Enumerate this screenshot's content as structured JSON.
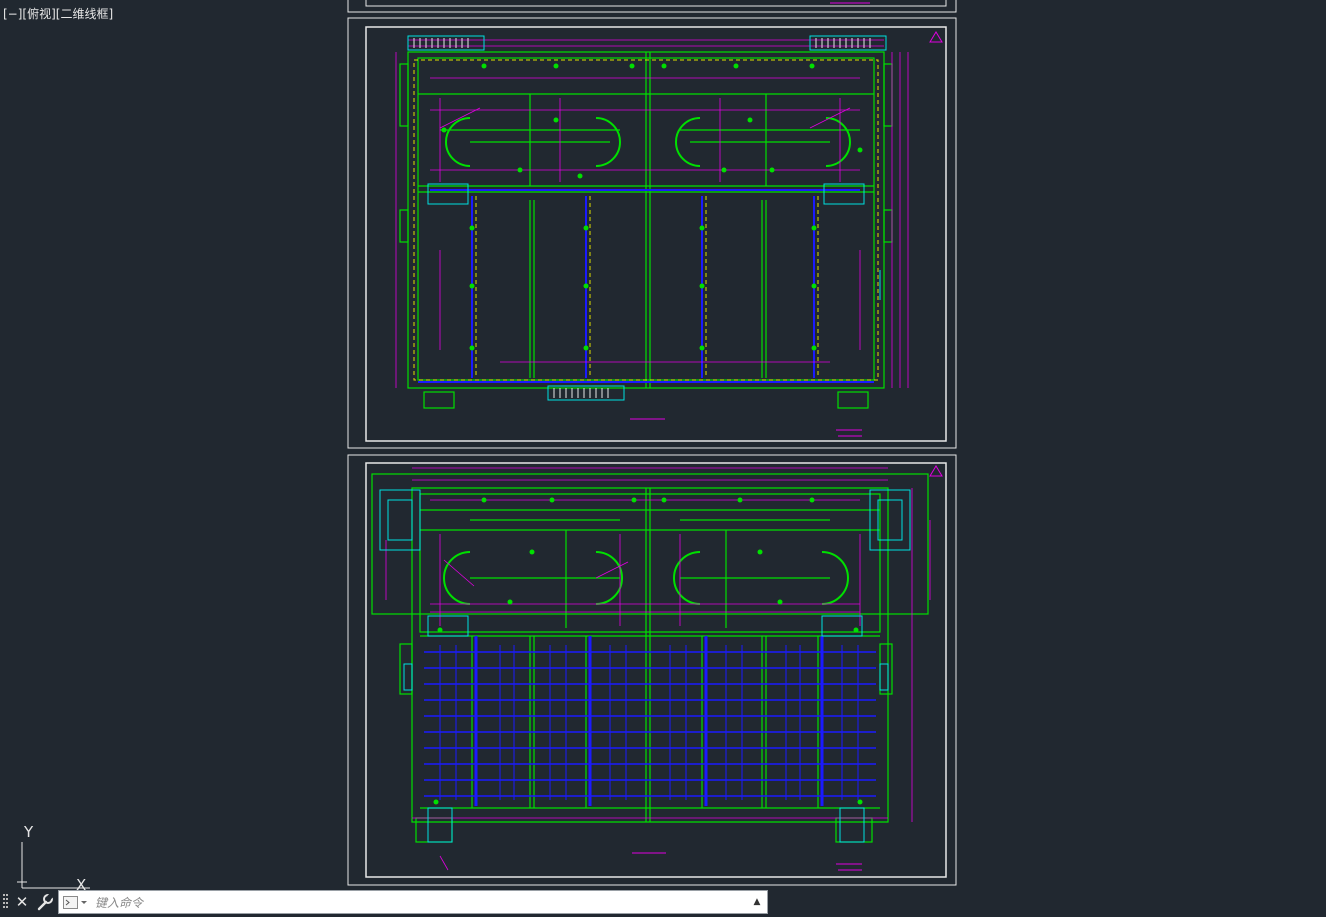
{
  "viewport": {
    "label": "[−][俯视][二维线框]"
  },
  "ucs": {
    "x_label": "X",
    "y_label": "Y"
  },
  "command_line": {
    "placeholder": "键入命令"
  },
  "colors": {
    "background": "#212830",
    "paper_border": "#e8e8e8",
    "walls": "#00e000",
    "dimensions": "#e000e0",
    "pipes": "#1a1aff",
    "equipment": "#00e0e0",
    "hidden": "#e0e000"
  },
  "icons": [
    "close-icon",
    "wrench-icon",
    "command-prompt-icon",
    "chevron-up-icon",
    "grip-icon"
  ]
}
